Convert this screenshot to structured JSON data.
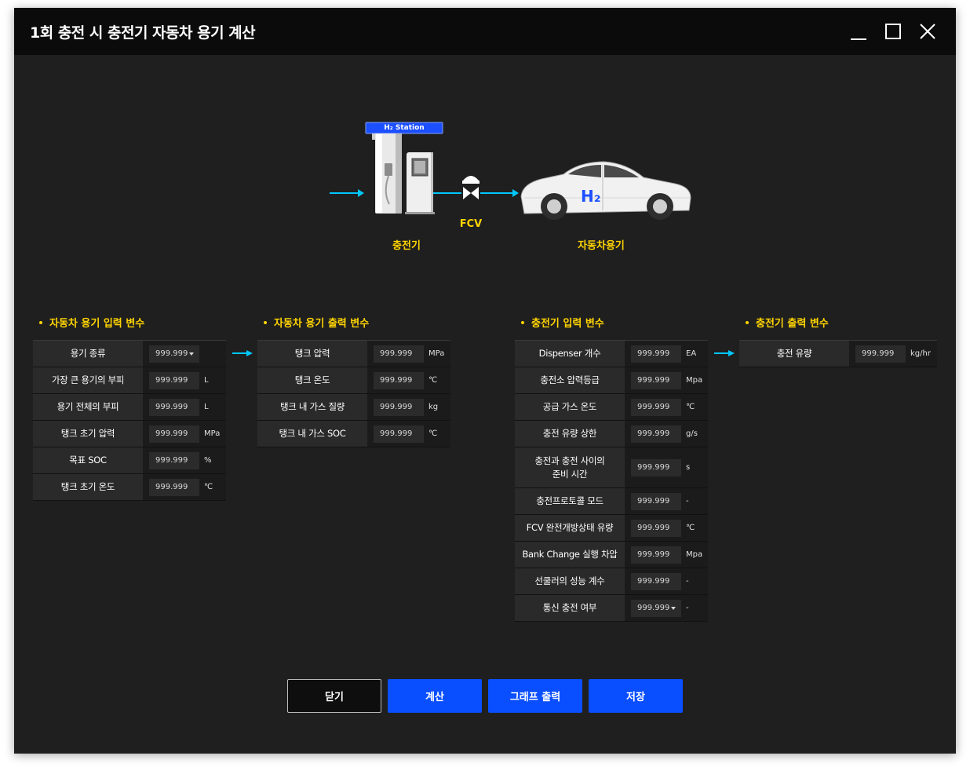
{
  "window": {
    "title": "1회 충전 시 충전기 자동차 용기 계산"
  },
  "diagram": {
    "station_sign": "H₂ Station",
    "station_label": "충전기",
    "valve_label": "FCV",
    "car_badge": "H₂",
    "car_label": "자동차용기",
    "arrow_color": "#00c8ff",
    "label_color": "#ffd400"
  },
  "sections": {
    "vehicle_input": {
      "title": "자동차 용기 입력 변수",
      "rows": [
        {
          "label": "용기 종류",
          "value": "999.999",
          "unit": "",
          "dropdown": true
        },
        {
          "label": "가장 큰 용기의 부피",
          "value": "999.999",
          "unit": "L"
        },
        {
          "label": "용기 전체의 부피",
          "value": "999.999",
          "unit": "L"
        },
        {
          "label": "탱크 초기 압력",
          "value": "999.999",
          "unit": "MPa"
        },
        {
          "label": "목표 SOC",
          "value": "999.999",
          "unit": "%"
        },
        {
          "label": "탱크 초기 온도",
          "value": "999.999",
          "unit": "℃"
        }
      ]
    },
    "vehicle_output": {
      "title": "자동차 용기 출력 변수",
      "rows": [
        {
          "label": "탱크 압력",
          "value": "999.999",
          "unit": "MPa"
        },
        {
          "label": "탱크 온도",
          "value": "999.999",
          "unit": "℃"
        },
        {
          "label": "탱크 내 가스 질량",
          "value": "999.999",
          "unit": "kg"
        },
        {
          "label": "탱크 내 가스 SOC",
          "value": "999.999",
          "unit": "℃"
        }
      ]
    },
    "charger_input": {
      "title": "충전기 입력 변수",
      "rows": [
        {
          "label": "Dispenser 개수",
          "value": "999.999",
          "unit": "EA"
        },
        {
          "label": "충전소 압력등급",
          "value": "999.999",
          "unit": "Mpa"
        },
        {
          "label": "공급 가스 온도",
          "value": "999.999",
          "unit": "℃"
        },
        {
          "label": "충전 유량 상한",
          "value": "999.999",
          "unit": "g/s"
        },
        {
          "label": "충전과 충전 사이의\n준비 시간",
          "value": "999.999",
          "unit": "s",
          "tall": true
        },
        {
          "label": "충전프로토콜 모드",
          "value": "999.999",
          "unit": "-"
        },
        {
          "label": "FCV 완전개방상태 유량",
          "value": "999.999",
          "unit": "℃"
        },
        {
          "label": "Bank Change 실행 차압",
          "value": "999.999",
          "unit": "Mpa"
        },
        {
          "label": "선쿨러의 성능 계수",
          "value": "999.999",
          "unit": "-"
        },
        {
          "label": "통신 충전 여부",
          "value": "999.999",
          "unit": "-",
          "dropdown": true
        }
      ]
    },
    "charger_output": {
      "title": "충전기 출력 변수",
      "rows": [
        {
          "label": "충전 유량",
          "value": "999.999",
          "unit": "kg/hr"
        }
      ]
    }
  },
  "buttons": {
    "close": "닫기",
    "calculate": "계산",
    "graph": "그래프 출력",
    "save": "저장"
  }
}
